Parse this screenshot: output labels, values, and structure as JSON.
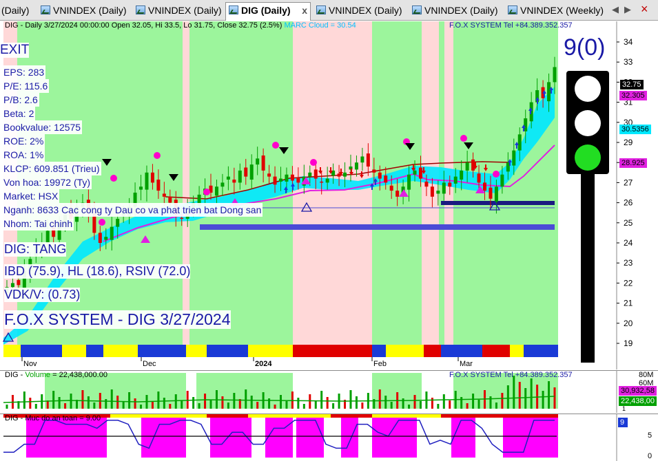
{
  "tabs": [
    {
      "label": "(Daily)",
      "active": false,
      "closable": false
    },
    {
      "label": "VNINDEX (Daily)",
      "active": false,
      "closable": false
    },
    {
      "label": "VNINDEX (Daily)",
      "active": false,
      "closable": false
    },
    {
      "label": "DIG (Daily)",
      "active": true,
      "closable": true
    },
    {
      "label": "VNINDEX (Daily)",
      "active": false,
      "closable": false
    },
    {
      "label": "VNINDEX (Daily)",
      "active": false,
      "closable": false
    },
    {
      "label": "VNINDEX (Weekly)",
      "active": false,
      "closable": false
    }
  ],
  "tab_close_glyph": "x",
  "tab_nav": {
    "left": "◀",
    "right": "▶",
    "close": "×"
  },
  "main_pane": {
    "header": "DIG - Daily 3/27/2024 00:00:00 Open 32.05, Hi 33.5, Lo 31.75, Close 32.75 (2.5%)",
    "marc_cloud": "MARC Cloud = 30.54",
    "fox_header": "F.O.X SYSTEM Tel +84.389.352.357",
    "signal": "EXIT",
    "fundamentals": [
      "EPS: 283",
      "P/E: 115.6",
      "P/B: 2.6",
      "Beta: 2",
      "Bookvalue: 12575",
      "ROE: 2%",
      "ROA: 1%",
      "KLCP: 609.851 (Trieu)",
      "Von hoa: 19972 (Ty)",
      "Market: HSX",
      "Nganh: 8633 Cac cong ty Dau co va phat trien bat Dong san",
      "Nhom: Tai chinh"
    ],
    "trend": "DIG: TANG",
    "ibd": "IBD (75.9), HL (18.6), RSIV (72.0)",
    "vdk": "VDK/V:  (0.73)",
    "fox_title": "F.O.X SYSTEM - DIG 3/27/2024",
    "count_label": "9(0)",
    "y_ticks": [
      "34",
      "33",
      "32",
      "31",
      "30",
      "29",
      "28",
      "27",
      "26",
      "25",
      "24",
      "23",
      "22",
      "21",
      "20",
      "19"
    ],
    "x_labels": [
      "Nov",
      "Dec",
      "2024",
      "Feb",
      "Mar"
    ],
    "price_tags": [
      {
        "text": "32.75",
        "bg": "#000000",
        "fg": "#ffffff"
      },
      {
        "text": "32.305",
        "bg": "#e020e0",
        "fg": "#000000"
      },
      {
        "text": "30.5356",
        "bg": "#00e8ff",
        "fg": "#000000"
      },
      {
        "text": "28.925",
        "bg": "#e020e0",
        "fg": "#000000"
      }
    ],
    "traffic_light": [
      "white",
      "white",
      "green"
    ]
  },
  "volume_pane": {
    "header_name": "DIG",
    "header_volume_label": "Volume",
    "header_volume_value": "= 22,438,000.00",
    "fox_header": "F.O.X SYSTEM Tel +84.389.352.357",
    "y_ticks": [
      "80M",
      "60M"
    ],
    "tags": [
      {
        "text": "30,932,58",
        "bg": "#e020e0",
        "fg": "#000000"
      },
      {
        "text": "22,438,00",
        "bg": "#00a000",
        "fg": "#ffffff"
      }
    ],
    "tick_1": "1"
  },
  "safety_pane": {
    "header": "DIG - Muc do an toan = 9.00",
    "y_ticks": [
      "5",
      "0"
    ],
    "tag": "9"
  },
  "chart_data": {
    "type": "candlestick",
    "title": "DIG - Daily",
    "ylim": [
      18.5,
      34.5
    ],
    "x_labels": [
      "Nov",
      "Dec",
      "2024",
      "Feb",
      "Mar"
    ],
    "last_bar": {
      "date": "3/27/2024",
      "open": 32.05,
      "high": 33.5,
      "low": 31.75,
      "close": 32.75,
      "change_pct": 2.5
    },
    "indicators": {
      "marc_cloud": 30.54,
      "ma_magenta": 28.925,
      "ma_pink": 32.305,
      "cloud_value": 30.5356
    },
    "volume_last": 22438000,
    "volume_ma": 30932580,
    "safety_level": 9.0
  },
  "colors": {
    "zone_green": "#9cf59c",
    "zone_pink": "#ffd8d8",
    "cloud": "#00e8ff",
    "candle_up": "#00a000",
    "candle_down": "#e00000",
    "text_blue": "#1a1aa6",
    "safety_magenta": "#ff00ff"
  }
}
